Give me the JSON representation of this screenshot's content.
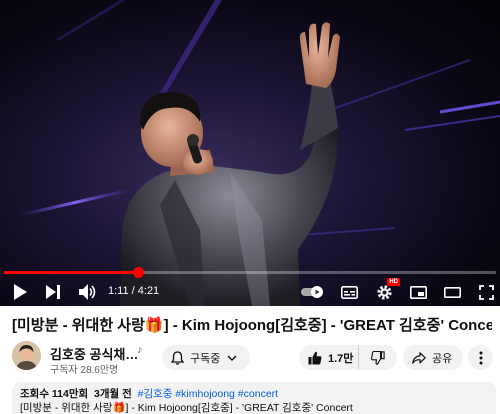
{
  "player": {
    "current_time": "1:11",
    "duration": "4:21",
    "time_separator": " / ",
    "progress": 0.272,
    "hd_badge": "HD",
    "accent_color": "#ff0000"
  },
  "video": {
    "title": "[미방분 - 위대한 사랑🎁] - Kim Hojoong[김호중] - 'GREAT 김호중' Concert"
  },
  "channel": {
    "name": "김호중 공식채…",
    "note": "♪",
    "subscribers": "구독자 28.6만명"
  },
  "actions": {
    "subscribe_label": "구독중",
    "like_count": "1.7만",
    "share_label": "공유"
  },
  "description": {
    "views": "조회수 114만회",
    "age": "3개월 전",
    "tags": "#김호중 #kimhojoong #concert",
    "first_line": "[미방분 - 위대한 사랑🎁] - Kim Hojoong[김호중] - 'GREAT 김호중' Concert"
  },
  "icons": {
    "play": "play-icon",
    "next": "next-icon",
    "volume": "volume-icon",
    "autoplay": "autoplay-toggle-icon",
    "captions": "captions-icon",
    "settings": "gear-icon",
    "miniplayer": "miniplayer-icon",
    "theater": "theater-mode-icon",
    "fullscreen": "fullscreen-icon",
    "bell": "bell-icon",
    "like": "thumbs-up-icon",
    "dislike": "thumbs-down-icon",
    "share": "share-icon",
    "more": "more-vert-icon"
  }
}
